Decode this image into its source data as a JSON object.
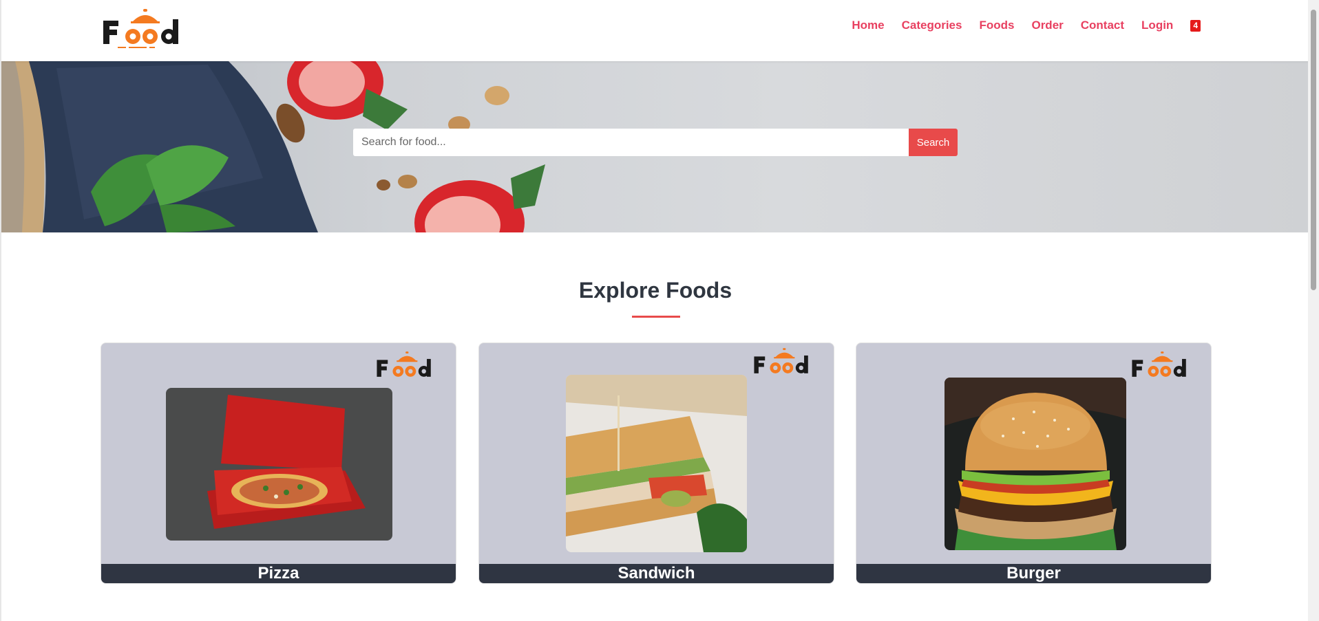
{
  "brand": {
    "logo_text": "Food",
    "accent": "#f47a20"
  },
  "nav": {
    "items": [
      "Home",
      "Categories",
      "Foods",
      "Order",
      "Contact",
      "Login"
    ],
    "cart_count": "4",
    "link_color": "#e84060"
  },
  "search": {
    "placeholder": "Search for food...",
    "button_label": "Search"
  },
  "explore": {
    "title": "Explore Foods",
    "cards": [
      {
        "label": "Pizza",
        "image": "pizza-box-photo"
      },
      {
        "label": "Sandwich",
        "image": "club-sandwich-photo"
      },
      {
        "label": "Burger",
        "image": "cheeseburger-photo"
      }
    ]
  }
}
